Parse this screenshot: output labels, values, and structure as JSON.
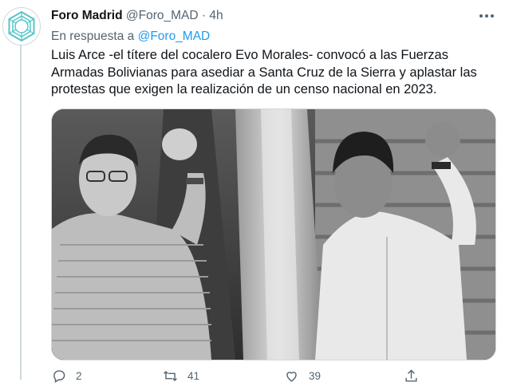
{
  "tweet": {
    "author_name": "Foro Madrid",
    "author_handle": "@Foro_MAD",
    "separator": "·",
    "time": "4h",
    "reply_prefix": "En respuesta a",
    "reply_to": "@Foro_MAD",
    "text": "Luis Arce -el títere del cocalero Evo Morales- convocó a las Fuerzas Armadas Bolivianas para asediar a Santa Cruz de la Sierra y aplastar las protestas que exigen la realización de un censo nacional en 2023.",
    "media": {
      "kind": "photo",
      "style": "black-and-white"
    },
    "actions": {
      "reply_count": "2",
      "retweet_count": "41",
      "like_count": "39"
    }
  },
  "icons": {
    "avatar": "hexagon-logo-icon",
    "more": "more-horizontal-icon",
    "reply": "reply-icon",
    "retweet": "retweet-icon",
    "like": "heart-icon",
    "share": "share-icon"
  },
  "colors": {
    "accent": "#1d9bf0",
    "muted": "#536471",
    "text": "#0f1419",
    "avatar_logo": "#57c5c6"
  }
}
